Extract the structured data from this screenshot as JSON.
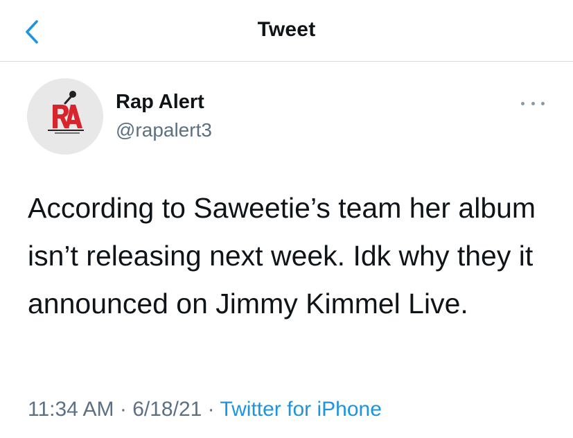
{
  "nav": {
    "title": "Tweet",
    "back_icon": "chevron-left-icon",
    "accent_color": "#1b95e0"
  },
  "tweet": {
    "author": {
      "name": "Rap Alert",
      "handle": "@rapalert3",
      "avatar_icon": "rap-alert-logo"
    },
    "more_icon": "ellipsis-icon",
    "text": "According to Saweetie’s team her album isn’t releasing next week. Idk why they it announced on Jimmy Kimmel Live.",
    "time": "11:34 AM",
    "separator": "·",
    "date": "6/18/21",
    "source": "Twitter for iPhone",
    "colors": {
      "text": "#0f1419",
      "secondary": "#5b7083",
      "link": "#1b95e0"
    }
  }
}
